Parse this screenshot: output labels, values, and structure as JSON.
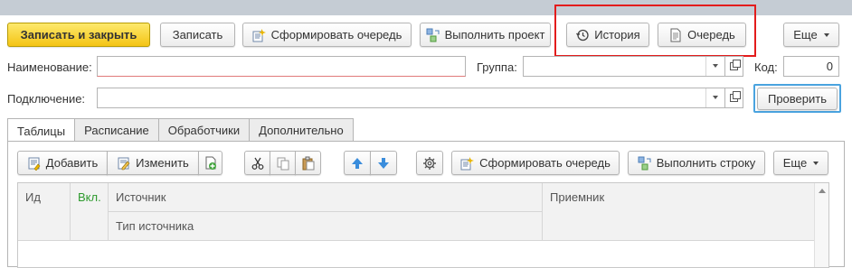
{
  "toolbar": {
    "save_close": "Записать и закрыть",
    "save": "Записать",
    "form_queue": "Сформировать очередь",
    "run_project": "Выполнить проект",
    "history": "История",
    "queue": "Очередь",
    "more": "Еще"
  },
  "form": {
    "name_label": "Наименование:",
    "name_value": "",
    "group_label": "Группа:",
    "group_value": "",
    "code_label": "Код:",
    "code_value": "0",
    "connection_label": "Подключение:",
    "connection_value": "",
    "check_button": "Проверить"
  },
  "tabs": [
    "Таблицы",
    "Расписание",
    "Обработчики",
    "Дополнительно"
  ],
  "table_toolbar": {
    "add": "Добавить",
    "edit": "Изменить",
    "form_queue": "Сформировать очередь",
    "run_row": "Выполнить строку",
    "more": "Еще"
  },
  "grid": {
    "columns": {
      "id": "Ид",
      "enabled": "Вкл.",
      "source": "Источник",
      "source_type": "Тип источника",
      "receiver": "Приемник"
    }
  },
  "colors": {
    "primary_button": "#f4c414",
    "highlight_frame": "#e31c1c",
    "focus_border": "#4aa3df",
    "enabled_column_text": "#2e9a2e"
  }
}
